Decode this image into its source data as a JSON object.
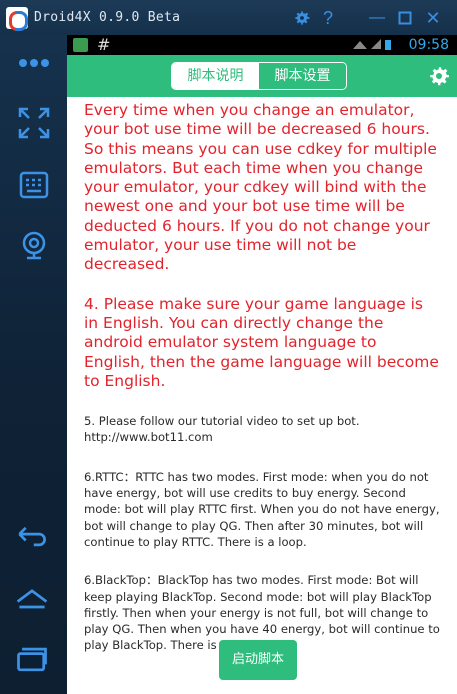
{
  "window": {
    "title": "Droid4X 0.9.0 Beta",
    "buttons": {
      "settings_icon": "gear-icon",
      "help_label": "?",
      "minimize_label": "—",
      "maximize_icon": "maximize-icon",
      "close_label": "✕"
    }
  },
  "statusbar": {
    "hash": "#",
    "time": "09:58"
  },
  "appbar": {
    "tabs": [
      {
        "label": "脚本说明",
        "active": false
      },
      {
        "label": "脚本设置",
        "active": true
      }
    ],
    "settings_icon": "gear-icon"
  },
  "content": {
    "paragraphs": [
      "Every time when you change an emulator,  your bot use time will be decreased 6 hours.  So this means you can use cdkey for multiple emulators. But each time when you change your emulator, your cdkey will bind with the newest one and your bot use time will be deducted 6 hours. If you do not change your emulator, your use time will not be decreased.",
      "4. Please make sure your game language is in English. You can directly change the android emulator system language to English, then the game language will become to English.",
      "5. Please follow our tutorial video to set up bot.  http://www.bot11.com",
      "6.RTTC：RTTC has two modes. First mode: when you do not have energy, bot will use credits to buy energy. Second mode: bot will play RTTC  first. When you do not have energy, bot will change to play QG. Then after 30 minutes, bot will continue to play RTTC. There is a loop.",
      "6.BlackTop：BlackTop has two modes. First mode: Bot will keep playing BlackTop. Second mode: bot will play BlackTop firstly. Then when your energy is not full, bot will change to play QG. Then when you have 40 energy, bot will continue to play BlackTop. There is a loop."
    ],
    "start_button": "启动脚本"
  },
  "sidebar": {
    "items": [
      {
        "icon": "more-dots-icon"
      },
      {
        "icon": "fullscreen-icon"
      },
      {
        "icon": "keyboard-icon"
      },
      {
        "icon": "camera-icon"
      },
      {
        "icon": "back-icon"
      },
      {
        "icon": "home-icon"
      },
      {
        "icon": "recent-apps-icon"
      }
    ]
  },
  "colors": {
    "accent_green": "#2ebd7c",
    "text_red": "#e3232c",
    "frame_blue": "#3c93e6"
  }
}
